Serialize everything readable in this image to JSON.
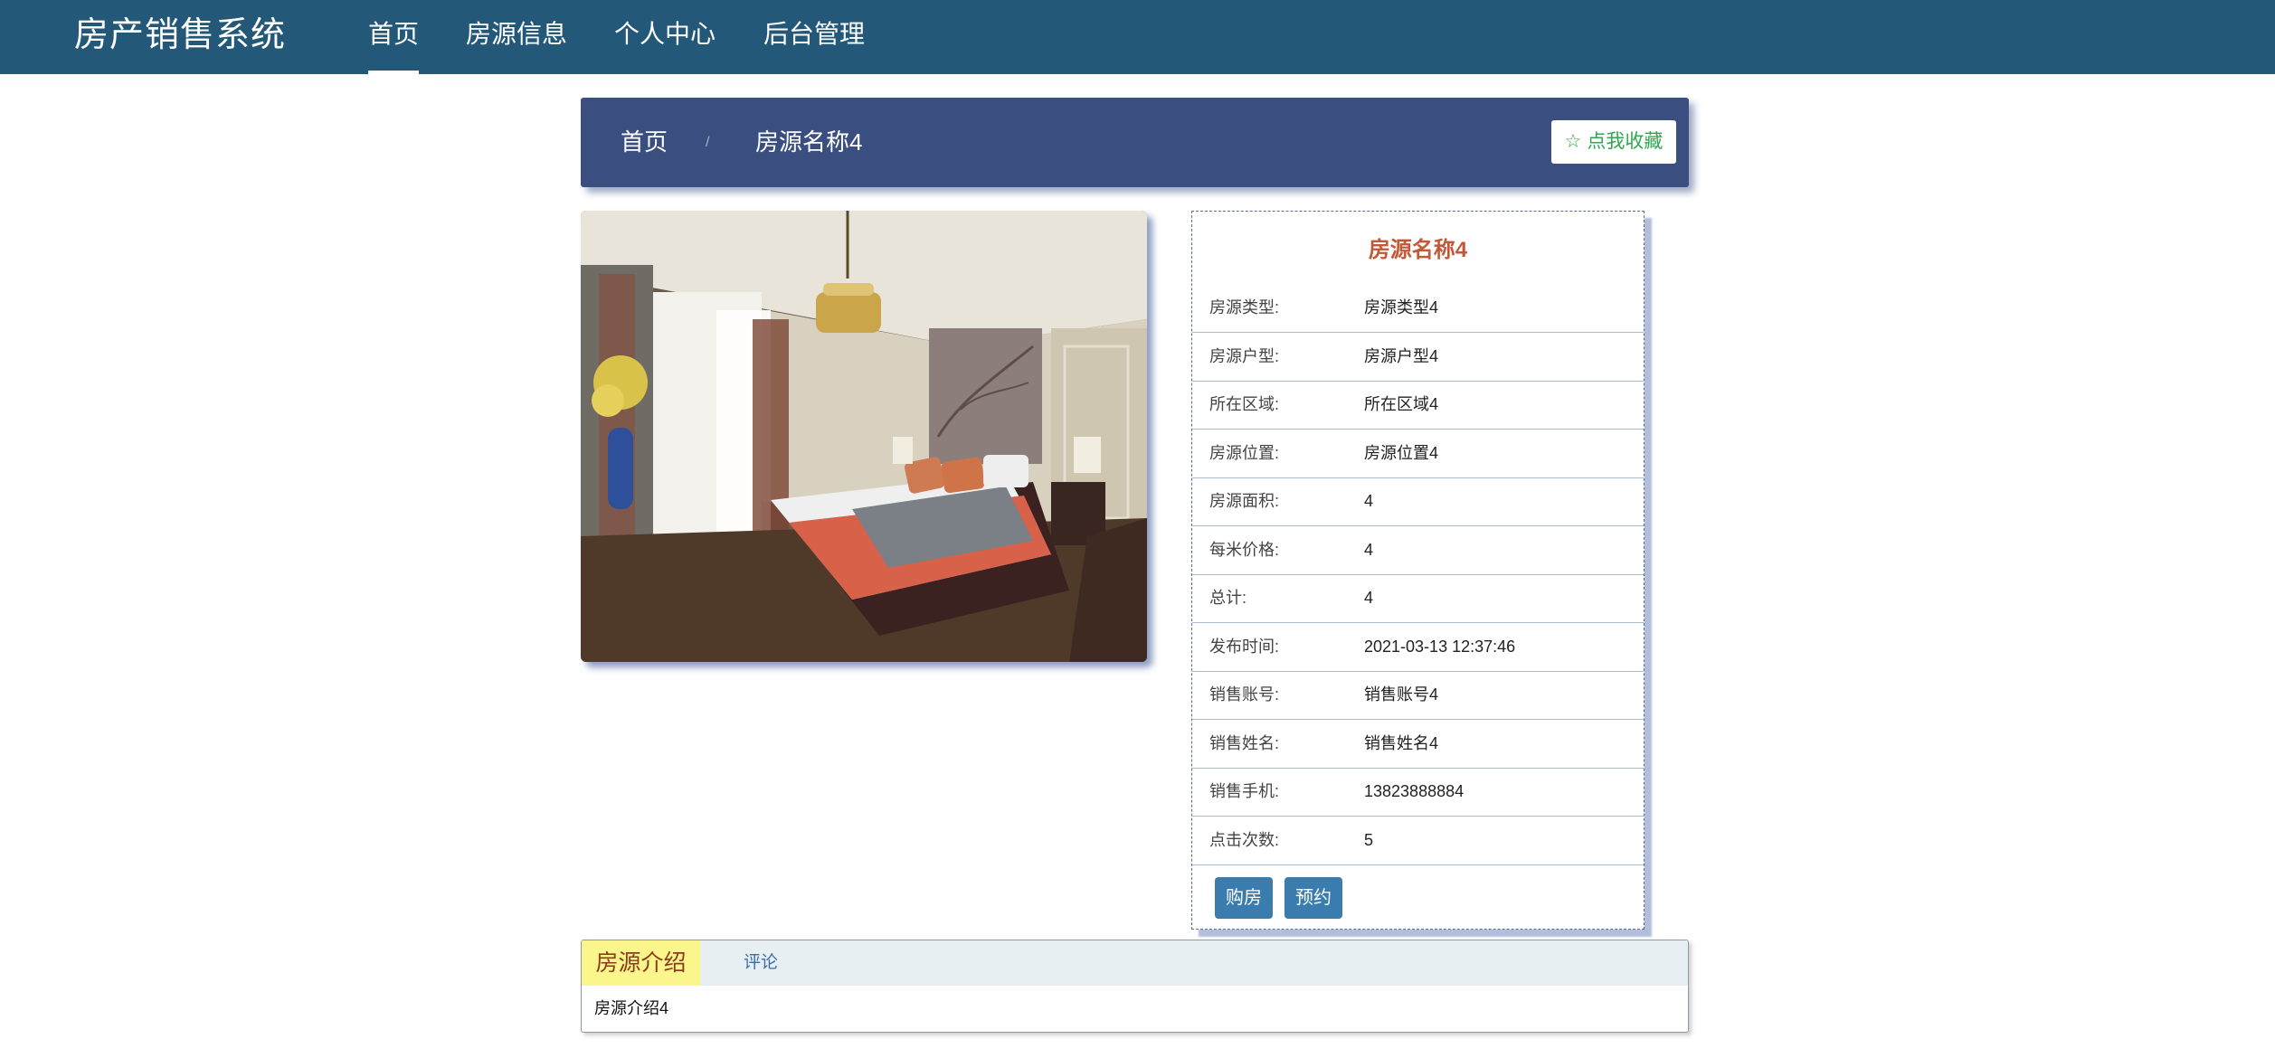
{
  "header": {
    "brand": "房产销售系统",
    "nav": [
      {
        "label": "首页",
        "active": true
      },
      {
        "label": "房源信息"
      },
      {
        "label": "个人中心"
      },
      {
        "label": "后台管理"
      }
    ]
  },
  "breadcrumb": {
    "home": "首页",
    "separator": "/",
    "current": "房源名称4",
    "favorite_label": "☆ 点我收藏"
  },
  "image": {
    "subject": "bedroom interior photo"
  },
  "details": {
    "title": "房源名称4",
    "rows": [
      {
        "label": "房源类型:",
        "value": "房源类型4"
      },
      {
        "label": "房源户型:",
        "value": "房源户型4"
      },
      {
        "label": "所在区域:",
        "value": "所在区域4"
      },
      {
        "label": "房源位置:",
        "value": "房源位置4"
      },
      {
        "label": "房源面积:",
        "value": "4"
      },
      {
        "label": "每米价格:",
        "value": "4"
      },
      {
        "label": "总计:",
        "value": "4"
      },
      {
        "label": "发布时间:",
        "value": "2021-03-13 12:37:46"
      },
      {
        "label": "销售账号:",
        "value": "销售账号4"
      },
      {
        "label": "销售姓名:",
        "value": "销售姓名4"
      },
      {
        "label": "销售手机:",
        "value": "13823888884"
      },
      {
        "label": "点击次数:",
        "value": "5"
      }
    ],
    "buy_label": "购房",
    "reserve_label": "预约"
  },
  "tabs": {
    "items": [
      {
        "label": "房源介绍",
        "active": true
      },
      {
        "label": "评论"
      }
    ],
    "content": "房源介绍4"
  },
  "colors": {
    "header_bg": "#245878",
    "breadcrumb_bg": "#3a4f7f",
    "accent_title": "#c25838",
    "button_blue": "#3b7cae",
    "favorite_green": "#2fa84f",
    "tab_active_bg": "#fbf68c"
  }
}
